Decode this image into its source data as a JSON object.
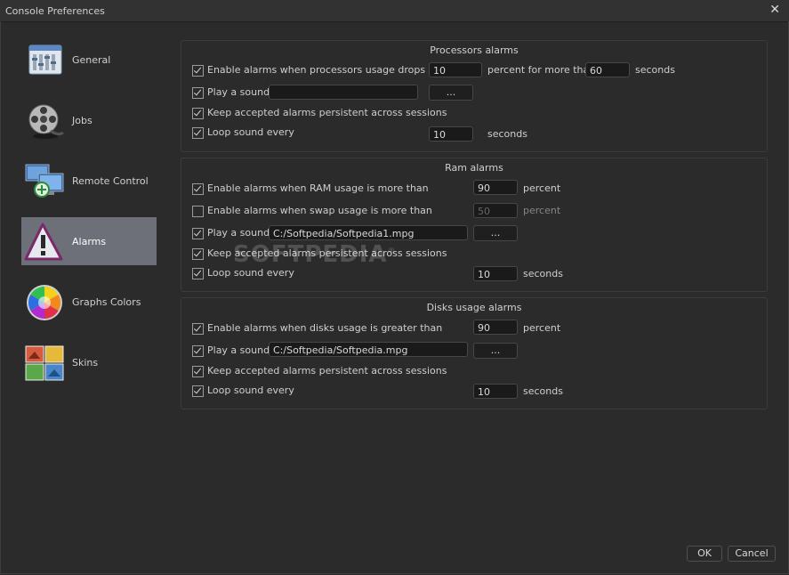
{
  "window": {
    "title": "Console Preferences",
    "close": "✕"
  },
  "sidebar": {
    "items": [
      {
        "label": "General",
        "icon": "window-settings-icon"
      },
      {
        "label": "Jobs",
        "icon": "film-reel-icon"
      },
      {
        "label": "Remote Control",
        "icon": "network-computers-icon"
      },
      {
        "label": "Alarms",
        "icon": "warning-triangle-icon",
        "selected": true
      },
      {
        "label": "Graphs Colors",
        "icon": "color-wheel-icon"
      },
      {
        "label": "Skins",
        "icon": "skins-tiles-icon"
      }
    ]
  },
  "processors": {
    "title": "Processors alarms",
    "enable_label": "Enable alarms when processors usage drops below",
    "enable_value": "10",
    "percent_for_label": "percent for more than",
    "duration_value": "60",
    "seconds_label": "seconds",
    "play_label": "Play a sound",
    "sound_path": "",
    "browse_label": "...",
    "persist_label": "Keep accepted alarms persistent across sessions",
    "loop_label": "Loop sound every",
    "loop_value": "10",
    "loop_unit": "seconds"
  },
  "ram": {
    "title": "Ram alarms",
    "enable_label": "Enable alarms when RAM usage is more than",
    "enable_value": "90",
    "percent_label": "percent",
    "swap_label": "Enable alarms when swap usage is more than",
    "swap_value": "50",
    "swap_unit": "percent",
    "play_label": "Play a sound",
    "sound_path": "C:/Softpedia/Softpedia1.mpg",
    "browse_label": "...",
    "persist_label": "Keep accepted alarms persistent across sessions",
    "loop_label": "Loop sound every",
    "loop_value": "10",
    "loop_unit": "seconds"
  },
  "disks": {
    "title": "Disks usage alarms",
    "enable_label": "Enable alarms when disks usage is greater than",
    "enable_value": "90",
    "percent_label": "percent",
    "play_label": "Play a sound",
    "sound_path": "C:/Softpedia/Softpedia.mpg",
    "browse_label": "...",
    "persist_label": "Keep accepted alarms persistent across sessions",
    "loop_label": "Loop sound every",
    "loop_value": "10",
    "loop_unit": "seconds"
  },
  "watermark": {
    "text": "SOFTPEDIA",
    "mark": "®"
  },
  "footer": {
    "ok_label": "OK",
    "cancel_label": "Cancel"
  }
}
